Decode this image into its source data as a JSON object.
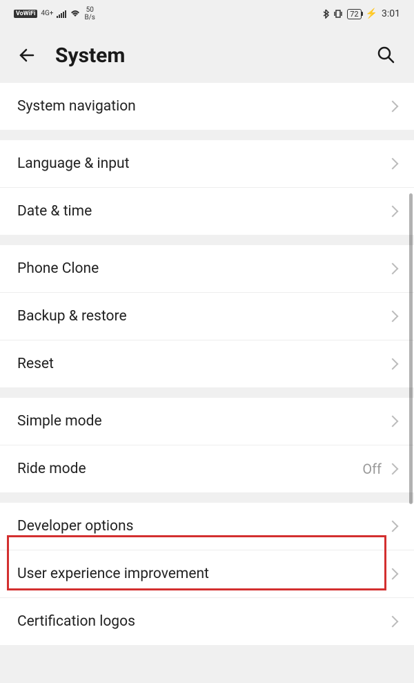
{
  "statusBar": {
    "vowifi": "VoWiFi",
    "network": "4G+",
    "dataRate": "50",
    "dataUnit": "B/s",
    "battery": "72",
    "time": "3:01"
  },
  "header": {
    "title": "System"
  },
  "sections": [
    {
      "rows": [
        {
          "label": "System navigation",
          "value": ""
        }
      ]
    },
    {
      "rows": [
        {
          "label": "Language & input",
          "value": ""
        },
        {
          "label": "Date & time",
          "value": ""
        }
      ]
    },
    {
      "rows": [
        {
          "label": "Phone Clone",
          "value": ""
        },
        {
          "label": "Backup & restore",
          "value": ""
        },
        {
          "label": "Reset",
          "value": ""
        }
      ]
    },
    {
      "rows": [
        {
          "label": "Simple mode",
          "value": ""
        },
        {
          "label": "Ride mode",
          "value": "Off"
        }
      ]
    },
    {
      "rows": [
        {
          "label": "Developer options",
          "value": ""
        },
        {
          "label": "User experience improvement",
          "value": ""
        },
        {
          "label": "Certification logos",
          "value": ""
        }
      ]
    }
  ]
}
